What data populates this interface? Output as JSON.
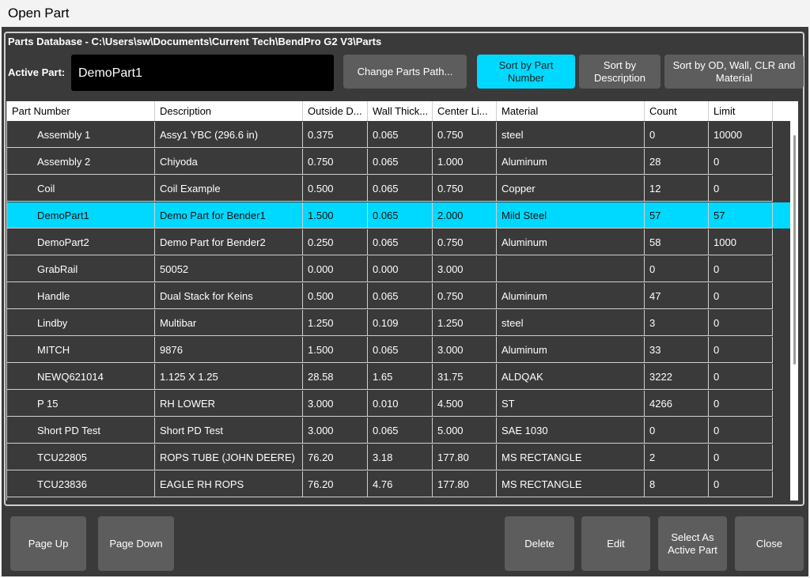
{
  "window": {
    "title": "Open Part"
  },
  "database": {
    "label": "Parts Database - C:\\Users\\sw\\Documents\\Current Tech\\BendPro G2 V3\\Parts"
  },
  "active_part": {
    "label": "Active Part:",
    "value": "DemoPart1"
  },
  "buttons": {
    "change_path": "Change Parts Path...",
    "sort_part_number": "Sort by Part Number",
    "sort_description": "Sort by Description",
    "sort_od": "Sort by OD, Wall, CLR and Material",
    "page_up": "Page Up",
    "page_down": "Page Down",
    "delete": "Delete",
    "edit": "Edit",
    "select_active": "Select As Active Part",
    "close": "Close"
  },
  "table": {
    "headers": [
      "Part Number",
      "Description",
      "Outside D...",
      "Wall Thick...",
      "Center Li...",
      "Material",
      "Count",
      "Limit"
    ],
    "rows": [
      [
        "Assembly 1",
        "Assy1 YBC (296.6 in)",
        "0.375",
        "0.065",
        "0.750",
        "steel",
        "0",
        "10000"
      ],
      [
        "Assembly 2",
        "Chiyoda",
        "0.750",
        "0.065",
        "1.000",
        "Aluminum",
        "28",
        "0"
      ],
      [
        "Coil",
        "Coil Example",
        "0.500",
        "0.065",
        "0.750",
        "Copper",
        "12",
        "0"
      ],
      [
        "DemoPart1",
        "Demo Part for Bender1",
        "1.500",
        "0.065",
        "2.000",
        "Mild Steel",
        "57",
        "57"
      ],
      [
        "DemoPart2",
        "Demo Part for Bender2",
        "0.250",
        "0.065",
        "0.750",
        "Aluminum",
        "58",
        "1000"
      ],
      [
        "GrabRail",
        "50052",
        "0.000",
        "0.000",
        "3.000",
        "",
        "0",
        "0"
      ],
      [
        "Handle",
        "Dual Stack for Keins",
        "0.500",
        "0.065",
        "0.750",
        "Aluminum",
        "47",
        "0"
      ],
      [
        "Lindby",
        "Multibar",
        "1.250",
        "0.109",
        "1.250",
        "steel",
        "3",
        "0"
      ],
      [
        "MITCH",
        "9876",
        "1.500",
        "0.065",
        "3.000",
        "Aluminum",
        "33",
        "0"
      ],
      [
        "NEWQ621014",
        "1.125 X 1.25",
        "28.58",
        "1.65",
        "31.75",
        "ALDQAK",
        "3222",
        "0"
      ],
      [
        "P 15",
        "RH LOWER",
        "3.000",
        "0.010",
        "4.500",
        "ST",
        "4266",
        "0"
      ],
      [
        "Short PD Test",
        "Short PD Test",
        "3.000",
        "0.065",
        "5.000",
        "SAE 1030",
        "0",
        "0"
      ],
      [
        "TCU22805",
        "ROPS TUBE (JOHN DEERE)",
        "76.20",
        "3.18",
        "177.80",
        "MS RECTANGLE",
        "2",
        "0"
      ],
      [
        "TCU23836",
        "EAGLE RH ROPS",
        "76.20",
        "4.76",
        "177.80",
        "MS RECTANGLE",
        "8",
        "0"
      ]
    ],
    "selected_row": 3
  },
  "colors": {
    "accent": "#00d9ff",
    "background": "#3a3a3a",
    "button": "#5d5d5d"
  }
}
